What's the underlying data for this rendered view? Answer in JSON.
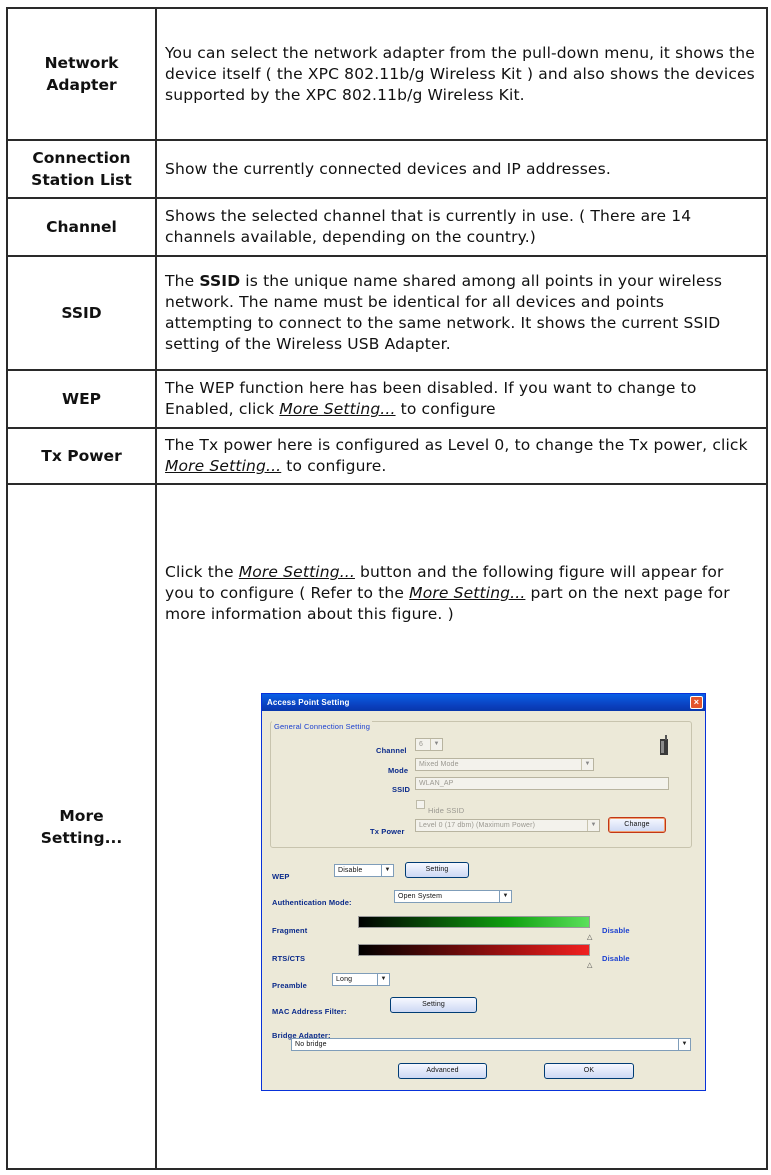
{
  "rows": [
    {
      "label": [
        "Network",
        "Adapter"
      ],
      "desc": "You can select the network adapter from the pull-down menu, it shows the device itself ( the XPC 802.11b/g Wireless Kit ) and also shows the devices supported by the XPC 802.11b/g Wireless Kit."
    },
    {
      "label": [
        "Connection",
        "Station List"
      ],
      "desc": "Show the currently connected devices and IP addresses."
    },
    {
      "label": [
        "Channel"
      ],
      "desc": "Shows the selected channel that is currently in use. ( There are 14 channels available, depending on the country.)"
    },
    {
      "label": [
        "SSID"
      ],
      "desc_bold": "SSID",
      "desc_pre": "The ",
      "desc_post": " is the unique name shared among all points in your wireless network. The name must be identical for all devices and points attempting to connect to the same network. It shows the current SSID setting of the Wireless USB Adapter."
    },
    {
      "label": [
        "WEP"
      ],
      "desc_pre": "The WEP function here has been disabled. If you want to change to Enabled, click ",
      "desc_link": "More Setting...",
      "desc_post": " to configure"
    },
    {
      "label": [
        "Tx Power"
      ],
      "desc_pre": "The Tx power here is configured as Level 0, to change the Tx power, click ",
      "desc_link": "More Setting...",
      "desc_post": " to configure."
    },
    {
      "label": [
        "More",
        "Setting..."
      ],
      "desc_a": "Click the ",
      "desc_link1": "More Setting...",
      "desc_b": " button and the following figure will appear for you to configure ( Refer to the ",
      "desc_link2": "More Setting...",
      "desc_c": " part on the next page for more information about this figure. )"
    }
  ],
  "dialog": {
    "title": "Access Point Setting",
    "close_glyph": "×",
    "group_title": "General Connection Setting",
    "channel_label": "Channel",
    "channel_value": "6",
    "mode_label": "Mode",
    "mode_value": "Mixed Mode",
    "ssid_label": "SSID",
    "ssid_value": "WLAN_AP",
    "hide_ssid_label": "Hide SSID",
    "txpower_label": "Tx Power",
    "txpower_value": "Level 0 (17 dbm) (Maximum Power)",
    "change_button": "Change",
    "wep_label": "WEP",
    "wep_value": "Disable",
    "setting_button": "Setting",
    "auth_label": "Authentication Mode:",
    "auth_value": "Open System",
    "fragment_label": "Fragment",
    "fragment_value": "Disable",
    "rtscts_label": "RTS/CTS",
    "rtscts_value": "Disable",
    "preamble_label": "Preamble",
    "preamble_value": "Long",
    "mac_label": "MAC Address Filter:",
    "mac_button": "Setting",
    "bridge_label": "Bridge Adapter:",
    "bridge_value": "No bridge",
    "advanced_button": "Advanced",
    "ok_button": "OK",
    "dropdown_glyph": "▼",
    "slider_glyph": "△",
    "colors": {
      "title_bar": "#0a4fd6",
      "body": "#ece9d8",
      "accent": "#1a3fd0"
    }
  }
}
